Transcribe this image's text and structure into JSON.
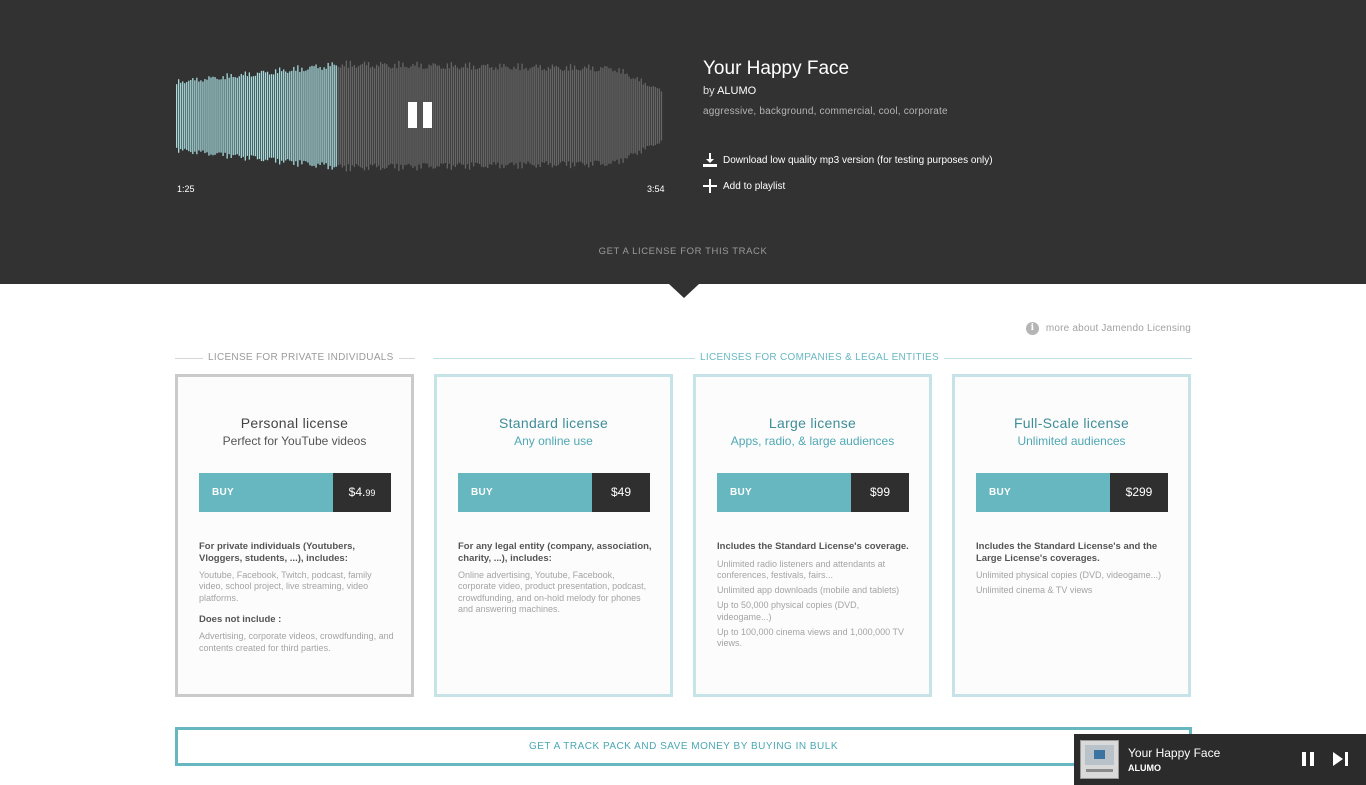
{
  "player": {
    "current_time": "1:25",
    "total_time": "3:54",
    "progress": 0.33,
    "track_title": "Your Happy Face",
    "by_prefix": "by",
    "artist": "ALUMO",
    "tags": "aggressive, background, commercial, cool, corporate",
    "download_label": "Download low quality mp3 version (for testing purposes only)",
    "playlist_label": "Add to playlist",
    "license_cta": "GET A LICENSE FOR THIS TRACK",
    "colors": {
      "played": "#a6d9dc",
      "unplayed": "#666666",
      "background": "#323232"
    }
  },
  "licensing": {
    "more_info": "more about Jamendo Licensing",
    "private_heading": "LICENSE FOR PRIVATE INDIVIDUALS",
    "company_heading": "LICENSES FOR COMPANIES & LEGAL ENTITIES",
    "buy_label": "BUY",
    "cards": [
      {
        "title": "Personal license",
        "subtitle": "Perfect for YouTube videos",
        "price_main": "$4.",
        "price_cents": "99",
        "intro": "For private individuals (Youtubers, Vloggers, students, ...), includes:",
        "items": [
          "Youtube, Facebook, Twitch, podcast, family video, school project, live streaming, video platforms."
        ],
        "exclude_heading": "Does not include :",
        "exclude_items": [
          "Advertising, corporate videos, crowdfunding, and contents created for third parties."
        ]
      },
      {
        "title": "Standard license",
        "subtitle": "Any online use",
        "price": "$49",
        "intro": "For any legal entity (company, association, charity, ...), includes:",
        "items": [
          "Online advertising, Youtube, Facebook, corporate video, product presentation, podcast, crowdfunding, and on-hold melody for phones and answering machines."
        ]
      },
      {
        "title": "Large license",
        "subtitle": "Apps, radio, & large audiences",
        "price": "$99",
        "intro": "Includes the Standard License's coverage.",
        "items": [
          "Unlimited radio listeners and attendants at conferences, festivals, fairs...",
          "Unlimited app downloads (mobile and tablets)",
          "Up to 50,000 physical copies (DVD, videogame...)",
          "Up to 100,000 cinema views and 1,000,000 TV views."
        ]
      },
      {
        "title": "Full-Scale license",
        "subtitle": "Unlimited audiences",
        "price": "$299",
        "intro": "Includes the Standard License's and the Large License's coverages.",
        "items": [
          "Unlimited physical copies (DVD, videogame...)",
          "Unlimited cinema & TV views"
        ]
      }
    ],
    "bulk_cta": "GET A TRACK PACK AND SAVE MONEY BY BUYING IN BULK"
  },
  "mini_player": {
    "title": "Your Happy Face",
    "artist": "ALUMO",
    "pause_icon": "pause-icon",
    "next_icon": "skip-next-icon"
  }
}
